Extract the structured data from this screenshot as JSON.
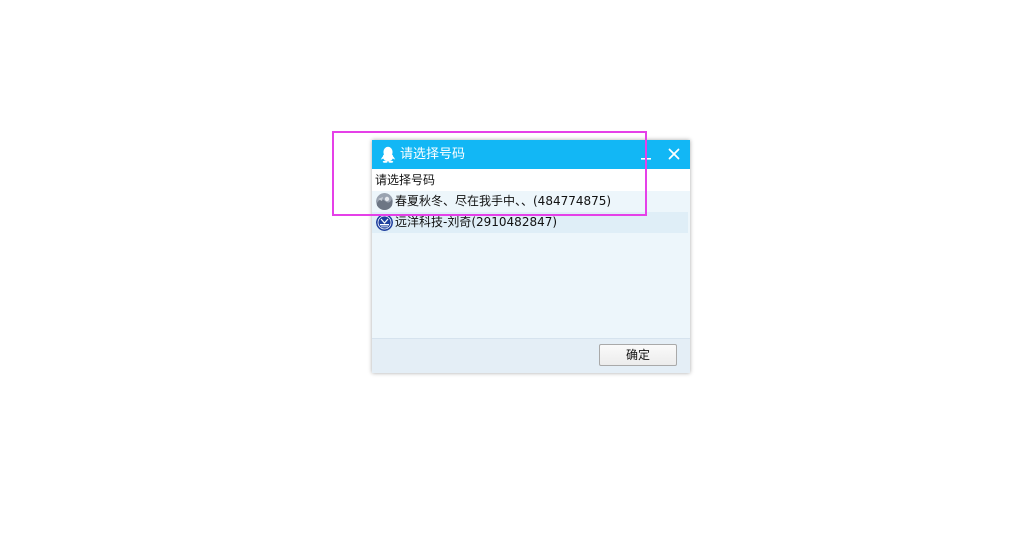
{
  "window": {
    "title": "请选择号码",
    "accent_color": "#12b7f5",
    "icons": {
      "app": "qq-penguin-icon",
      "minimize": "minimize-icon",
      "close": "close-icon"
    }
  },
  "dialog": {
    "prompt": "请选择号码",
    "accounts": [
      {
        "label": "春夏秋冬、尽在我手中、、(484774875)",
        "avatar": "avatar-icon"
      },
      {
        "label": "远洋科技-刘奇(2910482847)",
        "avatar": "avatar-icon"
      }
    ],
    "ok_label": "确定"
  },
  "annotation": {
    "highlight_color": "#e540e8"
  }
}
